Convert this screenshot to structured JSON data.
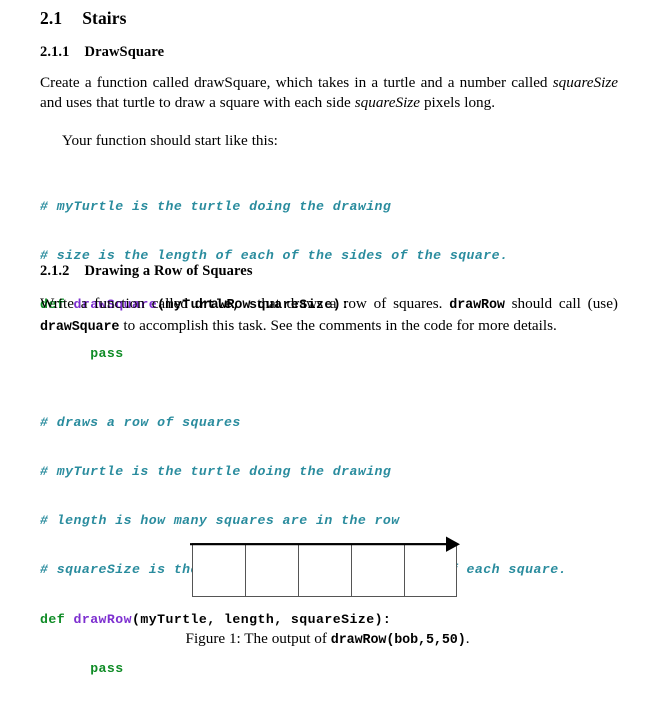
{
  "document": {
    "sections": {
      "stairs": {
        "number": "2.1",
        "title": "Stairs"
      },
      "drawsquare": {
        "number": "2.1.1",
        "title": "DrawSquare"
      },
      "drawrow": {
        "number": "2.1.2",
        "title": "Drawing a Row of Squares"
      }
    },
    "paragraphs": {
      "drawsquare_intro": {
        "part1": "Create a function called drawSquare, which takes in a turtle and a number called ",
        "em1": "squareSize",
        "part2": " and uses that turtle to draw a square with each side ",
        "em2": "squareSize",
        "part3": " pixels long."
      },
      "start_like_this": "Your function should start like this:",
      "drawrow_intro": {
        "part1": "Write a function called ",
        "code1": "drawRow",
        "part2": " that draws a row of squares. ",
        "code2": "drawRow",
        "part3": " should call (use) ",
        "code3": "drawSquare",
        "part4": " to accomplish this task. See the comments in the code for more details."
      }
    },
    "code_blocks": {
      "drawsquare": {
        "comment1": "# myTurtle is the turtle doing the drawing",
        "comment2": "# size is the length of each of the sides of the square.",
        "def_keyword": "def",
        "function_name": "drawSquare",
        "params": "(myTurtle, squareSize):",
        "body": "pass"
      },
      "drawrow": {
        "comment1": "# draws a row of squares",
        "comment2": "# myTurtle is the turtle doing the drawing",
        "comment3": "# length is how many squares are in the row",
        "comment4": "# squareSize is the length of each of the sides of each square.",
        "def_keyword": "def",
        "function_name": "drawRow",
        "params": "(myTurtle, length, squareSize):",
        "body": "pass"
      }
    },
    "figure": {
      "square_count": 5,
      "caption_prefix": "Figure 1: The output of ",
      "caption_code": "drawRow(bob,5,50)",
      "caption_suffix": "."
    },
    "colors": {
      "comment": "#2a8c9e",
      "keyword": "#0f8c26",
      "function": "#7d2fd0",
      "text": "#000000",
      "figure_stroke": "#555555"
    }
  }
}
